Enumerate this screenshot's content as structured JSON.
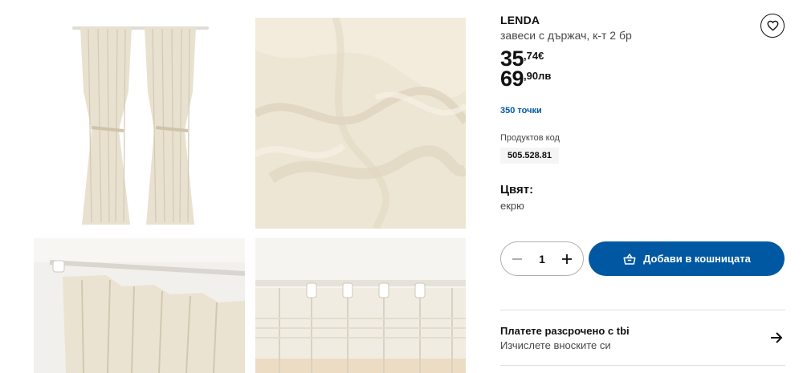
{
  "product": {
    "name": "LENDA",
    "description": "завеси с държач, к-т 2 бр",
    "price_eur": {
      "integer": "35",
      "decimal": ",74€"
    },
    "price_bgn": {
      "integer": "69",
      "decimal": ",90лв"
    },
    "points": "350 точки",
    "code_label": "Продуктов код",
    "code": "505.528.81",
    "color_label": "Цвят:",
    "color_value": "екрю"
  },
  "cart": {
    "quantity": "1",
    "add_label": "Добави в кошницата"
  },
  "installment": {
    "title": "Платете разсрочено с tbi",
    "subtitle": "Изчислете вноските си"
  },
  "icons": {
    "favorite": "heart-icon",
    "minus": "minus-icon",
    "plus": "plus-icon",
    "cart": "shopping-bag-icon",
    "arrow": "arrow-right-icon"
  },
  "colors": {
    "accent": "#0058a3",
    "fabric": "#ede5d4",
    "text": "#111111",
    "muted": "#484848"
  }
}
